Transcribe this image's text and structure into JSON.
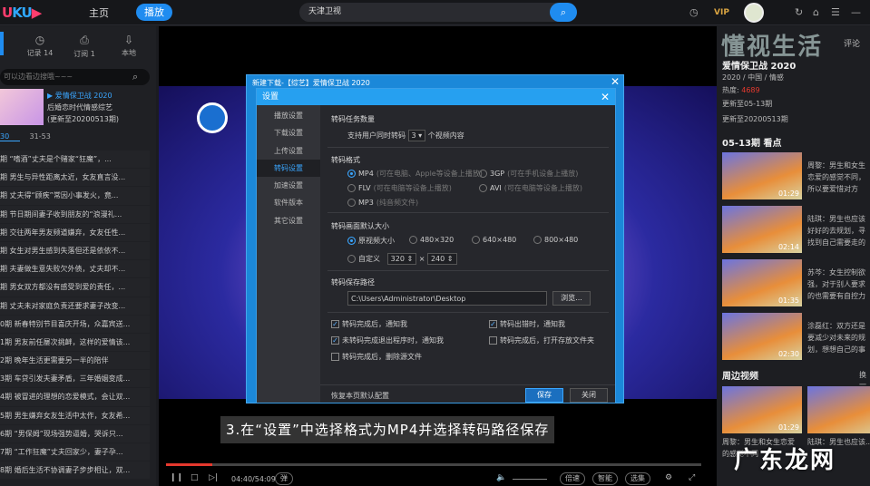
{
  "topbar": {
    "logo_a": "U",
    "logo_b": "KU",
    "logo_c": "▶",
    "home": "主页",
    "play": "播放",
    "search_value": "天津卫视",
    "search_icon": "⌕",
    "vip": "VIP",
    "icons": [
      "◷",
      "↻",
      "⌂",
      "☰",
      "—"
    ]
  },
  "left": {
    "tabs": [
      {
        "icon": "◷",
        "label": "记录 14"
      },
      {
        "icon": "⎙",
        "label": "订阅 1"
      },
      {
        "icon": "⇩",
        "label": "本地"
      }
    ],
    "search_placeholder": "可以边看边搜哦~~~",
    "show_title": "▶ 爱情保卫战 2020",
    "show_desc": "后婚恋时代情感综艺",
    "show_update": "(更新至20200513期)",
    "ep_tabs": [
      "30",
      "31-53"
    ],
    "episodes": [
      "期 “嗜酒”丈夫是个赌家“狂魔”，...",
      "期 男生与异性距离太近，女友直言没...",
      "期 丈夫得“顾疾”常因小事发火，竟...",
      "期 节日期间妻子收到朋友的“浪漫礼...",
      "期 交往两年男友频道嫌弃，女友任性...",
      "期 女生对男生感到失落但还是依依不...",
      "期 夫妻做生意失败欠外债，丈夫却不...",
      "期 男女双方都没有感受到爱的责任，...",
      "期 丈夫未对家庭负责还要求妻子改变...",
      "0期 新春特别节目喜庆开场，众嘉宾送...",
      "1期 男友前任屡次挑衅，这样的爱情该...",
      "2期 晚年生活更需要另一半的陪伴",
      "3期 车贷引发夫妻矛盾，三年婚姻变成...",
      "4期 被冒进的理想的恋爱模式，会让双...",
      "5期 男生嫌弃女友生活中太作，女友希...",
      "6期 “男保姆”现场强势逼婚，哭诉只...",
      "7期 “工作狂魔”丈夫回家少，妻子孕...",
      "8期 婚后生活不协调妻子步步相让，双..."
    ]
  },
  "player": {
    "caption": "3.在“设置”中选择格式为MP4并选择转码路径保存",
    "time": "04:40/54:09",
    "progress": 0.086,
    "danmu": "弹",
    "speed": "倍速",
    "smart": "智能",
    "episodes": "选集",
    "icons": {
      "pause": "❙❙",
      "stop": "□",
      "next": "▷|",
      "volume": "🔈",
      "settings": "⚙",
      "fullscreen": "⤢"
    }
  },
  "dialog": {
    "outer_title": "新建下载-【综艺】爱情保卫战 2020",
    "title": "设置",
    "close": "✕",
    "menu": [
      "播放设置",
      "下载设置",
      "上传设置",
      "转码设置",
      "加速设置",
      "软件版本",
      "其它设置"
    ],
    "task_section": "转码任务数量",
    "task_label": "支持用户同时转码",
    "task_value": "3",
    "task_suffix": "个视频内容",
    "format_section": "转码格式",
    "formats": [
      {
        "name": "MP4",
        "hint": "(可在电脑、Apple等设备上播放)",
        "checked": true
      },
      {
        "name": "3GP",
        "hint": "(可在手机设备上播放)",
        "checked": false
      },
      {
        "name": "FLV",
        "hint": "(可在电脑等设备上播放)",
        "checked": false
      },
      {
        "name": "AVI",
        "hint": "(可在电脑等设备上播放)",
        "checked": false
      },
      {
        "name": "MP3",
        "hint": "(纯音频文件)",
        "checked": false
      }
    ],
    "size_section": "转码画面默认大小",
    "sizes": [
      "原视频大小",
      "480×320",
      "640×480",
      "800×480"
    ],
    "custom_label": "自定义",
    "custom_w": "320",
    "custom_x": "×",
    "custom_h": "240",
    "path_section": "转码保存路径",
    "path_value": "C:\\Users\\Administrator\\Desktop",
    "browse": "浏览...",
    "checks": [
      {
        "label": "转码完成后，通知我",
        "checked": true
      },
      {
        "label": "转码出错时，通知我",
        "checked": true
      },
      {
        "label": "未转码完成退出程序时，通知我",
        "checked": true
      },
      {
        "label": "转码完成后，打开存放文件夹",
        "checked": false
      },
      {
        "label": "转码完成后，删除源文件",
        "checked": false
      }
    ],
    "restore": "恢复本页默认配置",
    "save": "保存",
    "close_btn": "关闭"
  },
  "right": {
    "watermark": "懂视生活",
    "comment_tab": "评论",
    "show_title": "爱情保卫战 2020",
    "meta": "2020 / 中国 / 情感",
    "heat_label": "热度:",
    "heat_value": "4689",
    "update1": "更新至05-13期",
    "update2": "更新至20200513期",
    "highlights_title": "05-13期 看点",
    "highlights": [
      {
        "dur": "01:29",
        "text": "周黎：男生和女生恋爱的感觉不同，所以要爱惜对方"
      },
      {
        "dur": "02:14",
        "text": "陆琪：男生也应该好好的去规划，寻找到自己需要走的路"
      },
      {
        "dur": "01:35",
        "text": "苏芩：女生控制欲强，对于别人要求的也需要有自控力"
      },
      {
        "dur": "02:30",
        "text": "涂磊红：双方还是要减少对未来的规划，想想自己的事业"
      }
    ],
    "nearby_title": "周边视频",
    "nearby_more": "换一",
    "nearby": [
      {
        "dur": "01:29",
        "text": "周黎：男生和女生恋爱的感觉不同"
      },
      {
        "dur": "",
        "text": "陆琪：男生也应该..."
      }
    ],
    "site_watermark": "广东龙网",
    "heat_color": "#e5392e"
  }
}
